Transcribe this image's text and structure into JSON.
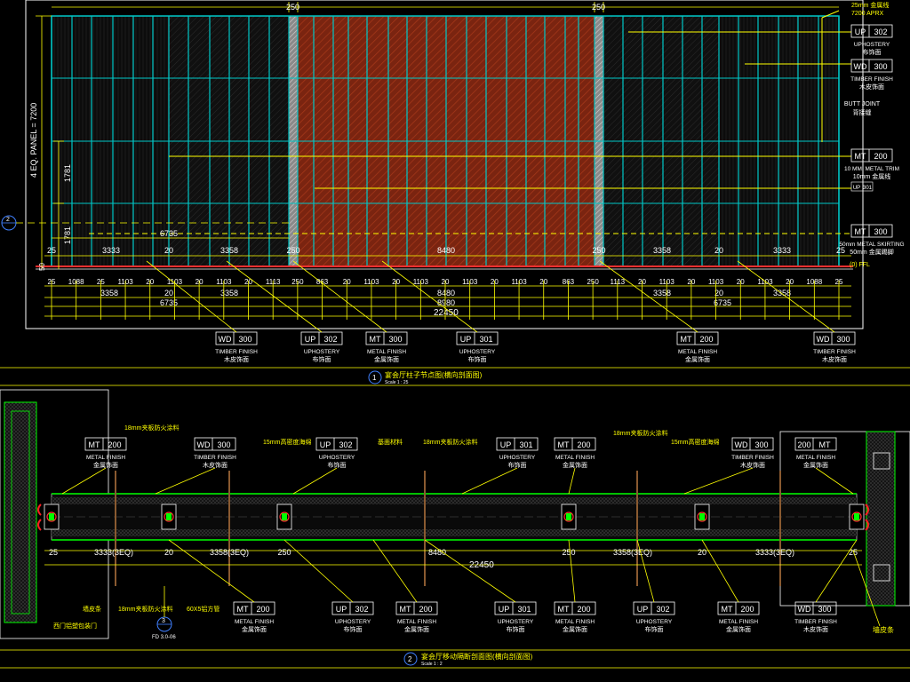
{
  "colors": {
    "background": "#000000",
    "frame": "#ffffff",
    "line_cyan": "#00c8c8",
    "line_yellow": "#ffff00",
    "line_green": "#00ff00",
    "line_red": "#ff2020",
    "panel_red": "#8a2a10",
    "tag_blue": "#2a6cff",
    "text_white": "#ffffff"
  },
  "upper": {
    "top_dims": [
      "250",
      "250"
    ],
    "top_right_note_1": "25mm 金属线",
    "top_right_note_2": "7200 APRX",
    "left_vertical_label": "4 EQ. PANEL = 7200",
    "left_dim_a": "1781",
    "left_dim_b": "1781",
    "row_6735": "6735",
    "row_dims": [
      "25",
      "3333",
      "20",
      "3358",
      "250",
      "8480",
      "250",
      "3358",
      "20",
      "3333",
      "25"
    ],
    "left_edge_50": "50",
    "fine_dims": [
      "25",
      "1088",
      "25",
      "1103",
      "20",
      "1103",
      "20",
      "1103",
      "20",
      "1113",
      "250",
      "863",
      "20",
      "1103",
      "20",
      "1103",
      "20",
      "1103",
      "20",
      "1103",
      "20",
      "863",
      "250",
      "1113",
      "20",
      "1103",
      "20",
      "1103",
      "20",
      "1103",
      "20",
      "1088",
      "25"
    ],
    "sum_a": [
      "3358",
      "20",
      "3358",
      "8480",
      "3358",
      "20",
      "3358"
    ],
    "sum_b": [
      "6735",
      "8980",
      "6735"
    ],
    "total": "22450",
    "section_marker": "2",
    "right_tags": [
      {
        "code": "UP",
        "num": "302",
        "en": "UPHOSTERY",
        "cn": "布饰面"
      },
      {
        "code": "WD",
        "num": "300",
        "en": "TIMBER FINISH",
        "cn": "木皮饰面"
      },
      {
        "code": "",
        "num": "",
        "en": "BUTT JOINT",
        "cn": "背接缝"
      },
      {
        "code": "MT",
        "num": "200",
        "en": "10 MM. METAL TRIM",
        "cn": "10mm 金属线"
      },
      {
        "code": "UP",
        "num": "301",
        "en": "",
        "cn": ""
      },
      {
        "code": "MT",
        "num": "300",
        "en": "50mm METAL SKIRTING",
        "cn": "50mm 金属踢脚"
      }
    ],
    "ffl": "(0) FFL",
    "bottom_tags": [
      {
        "code": "WD",
        "num": "300",
        "en": "TIMBER FINISH",
        "cn": "木皮饰面"
      },
      {
        "code": "UP",
        "num": "302",
        "en": "UPHOSTERY",
        "cn": "布饰面"
      },
      {
        "code": "MT",
        "num": "300",
        "en": "METAL FINISH",
        "cn": "金属饰面"
      },
      {
        "code": "UP",
        "num": "301",
        "en": "UPHOSTERY",
        "cn": "布饰面"
      },
      {
        "code": "MT",
        "num": "200",
        "en": "METAL FINISH",
        "cn": "金属饰面"
      },
      {
        "code": "WD",
        "num": "300",
        "en": "TIMBER FINISH",
        "cn": "木皮饰面"
      }
    ],
    "title_number": "1",
    "title": "宴会厅柱子节点图(横向剖面图)",
    "scale": "Scale 1 : 25"
  },
  "lower": {
    "top_notes": [
      "18mm夹板防火涂料",
      "15mm高密度海绵",
      "基面材料",
      "18mm夹板防火涂料",
      "18mm夹板防火涂料",
      "15mm高密度海绵"
    ],
    "top_tags": [
      {
        "code": "MT",
        "num": "200",
        "en": "METAL FINISH",
        "cn": "金属饰面"
      },
      {
        "code": "WD",
        "num": "300",
        "en": "TIMBER FINISH",
        "cn": "木皮饰面"
      },
      {
        "code": "UP",
        "num": "302",
        "en": "UPHOSTERY",
        "cn": "布饰面"
      },
      {
        "code": "UP",
        "num": "301",
        "en": "UPHOSTERY",
        "cn": "布饰面"
      },
      {
        "code": "MT",
        "num": "200",
        "en": "METAL FINISH",
        "cn": "金属饰面"
      },
      {
        "code": "WD",
        "num": "300",
        "en": "TIMBER FINISH",
        "cn": "木皮饰面"
      },
      {
        "code": "200",
        "num": "MT",
        "en": "METAL FINISH",
        "cn": "金属饰面"
      }
    ],
    "dims": [
      "25",
      "3333(3EQ)",
      "20",
      "3358(3EQ)",
      "250",
      "8480",
      "250",
      "3358(3EQ)",
      "20",
      "3333(3EQ)",
      "25"
    ],
    "total": "22450",
    "bottom_notes": [
      "墙皮条",
      "18mm夹板防火涂料",
      "60X5铝方管",
      "西门铝塑包装门"
    ],
    "bottom_tags": [
      {
        "code": "MT",
        "num": "200",
        "en": "METAL FINISH",
        "cn": "金属饰面"
      },
      {
        "code": "UP",
        "num": "302",
        "en": "UPHOSTERY",
        "cn": "布饰面"
      },
      {
        "code": "MT",
        "num": "200",
        "en": "METAL FINISH",
        "cn": "金属饰面"
      },
      {
        "code": "UP",
        "num": "301",
        "en": "UPHOSTERY",
        "cn": "布饰面"
      },
      {
        "code": "MT",
        "num": "200",
        "en": "METAL FINISH",
        "cn": "金属饰面"
      },
      {
        "code": "UP",
        "num": "302",
        "en": "UPHOSTERY",
        "cn": "布饰面"
      },
      {
        "code": "MT",
        "num": "200",
        "en": "METAL FINISH",
        "cn": "金属饰面"
      },
      {
        "code": "WD",
        "num": "300",
        "en": "TIMBER FINISH",
        "cn": "木皮饰面"
      }
    ],
    "section_ref_top": "3",
    "section_ref_bottom": "FD 3.0-06",
    "right_note": "墙皮条",
    "title_number": "2",
    "title": "宴会厅移动隔断剖面图(横向剖面图)",
    "scale": "Scale 1 : 2"
  }
}
